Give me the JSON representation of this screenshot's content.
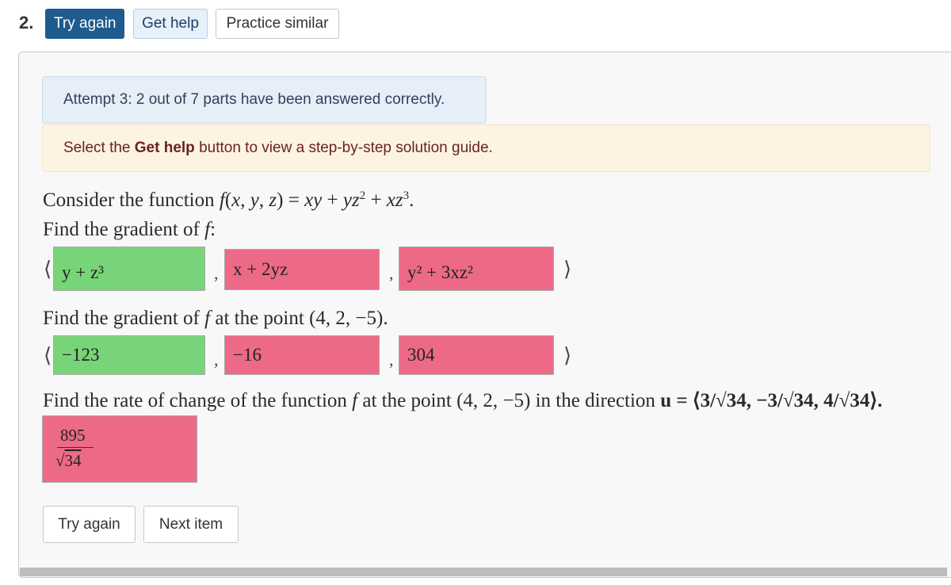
{
  "question": {
    "number": "2.",
    "buttons": {
      "try_again": "Try again",
      "get_help": "Get help",
      "practice_similar": "Practice similar"
    }
  },
  "alerts": {
    "attempt": "Attempt 3: 2 out of 7 parts have been answered correctly.",
    "help_prefix": "Select the ",
    "help_bold": "Get help",
    "help_suffix": " button to view a step-by-step solution guide."
  },
  "problem": {
    "intro": "Consider the function",
    "function_lhs": "f(x, y, z) = xy + yz",
    "part1": "Find the gradient of",
    "part2_prefix": "Find the gradient of",
    "part2_suffix": "at the point (4, 2, −5).",
    "part3_prefix": "Find the rate of change of the function",
    "part3_suffix": "at the point (4, 2, −5) in the direction",
    "direction": "u = ⟨3/√34, −3/√34, 4/√34⟩."
  },
  "answers": {
    "gradient": [
      {
        "value": "y + z³",
        "status": "correct"
      },
      {
        "value": "x + 2yz",
        "status": "incorrect"
      },
      {
        "value": "y² + 3xz²",
        "status": "incorrect"
      }
    ],
    "gradient_at_point": [
      {
        "value": "−123",
        "status": "correct"
      },
      {
        "value": "−16",
        "status": "incorrect"
      },
      {
        "value": "304",
        "status": "incorrect"
      }
    ],
    "rate_of_change": {
      "numerator": "895",
      "denominator": "34",
      "status": "incorrect"
    }
  },
  "footer": {
    "try_again": "Try again",
    "next_item": "Next item"
  },
  "colors": {
    "correct": "#78d479",
    "incorrect": "#ec6a86",
    "primary": "#1f5b8e"
  }
}
